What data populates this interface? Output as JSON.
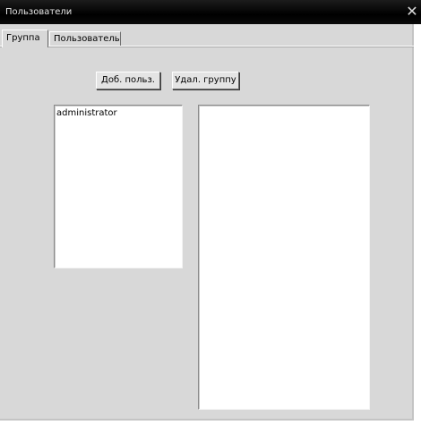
{
  "window": {
    "title": "Пользователи",
    "close_glyph": "✕"
  },
  "tabs": [
    {
      "label": "Группа",
      "active": true
    },
    {
      "label": "Пользователь",
      "active": false
    }
  ],
  "toolbar": {
    "add_user_label": "Доб. польз.",
    "delete_group_label": "Удал. группу"
  },
  "groups_list": {
    "items": [
      "administrator"
    ]
  },
  "members_list": {
    "items": []
  },
  "icons": {
    "close": "close-icon"
  }
}
